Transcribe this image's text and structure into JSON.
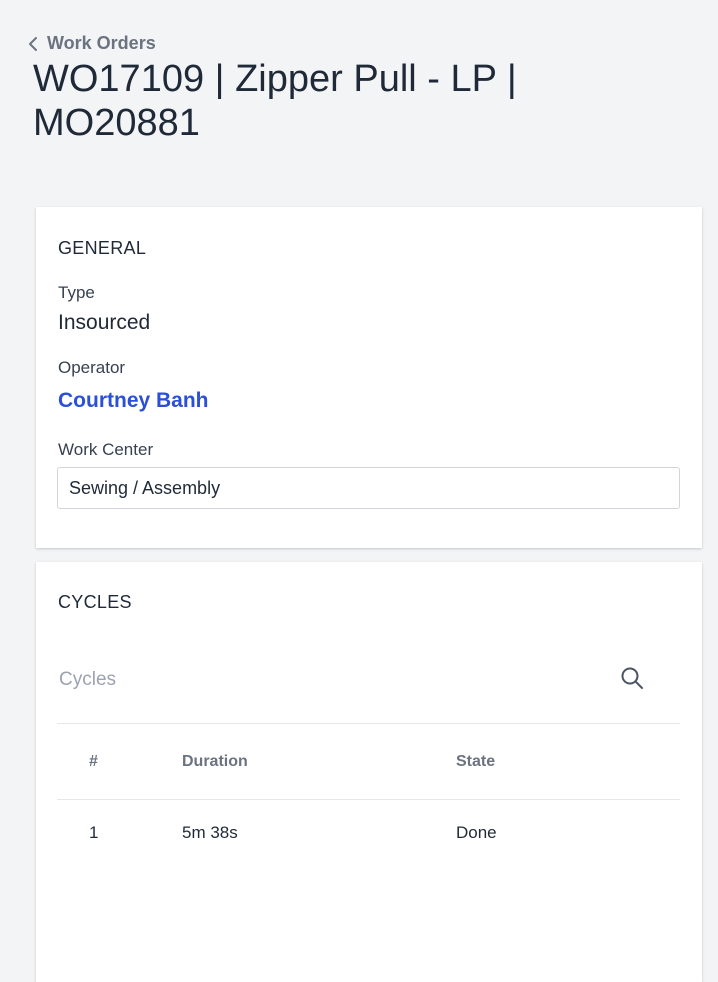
{
  "header": {
    "back_label": "Work Orders",
    "title": "WO17109 | Zipper Pull - LP | MO20881"
  },
  "general": {
    "section_title": "GENERAL",
    "type_label": "Type",
    "type_value": "Insourced",
    "operator_label": "Operator",
    "operator_value": "Courtney Banh",
    "work_center_label": "Work Center",
    "work_center_value": "Sewing / Assembly"
  },
  "cycles": {
    "section_title": "CYCLES",
    "search_placeholder": "Cycles",
    "search_icon": "search-icon",
    "columns": [
      "#",
      "Duration",
      "State"
    ],
    "rows": [
      {
        "num": "1",
        "duration": "5m 38s",
        "state": "Done"
      }
    ]
  },
  "colors": {
    "background": "#f3f4f6",
    "link": "#2b4fd7",
    "card": "#ffffff",
    "muted": "#6b7280"
  }
}
